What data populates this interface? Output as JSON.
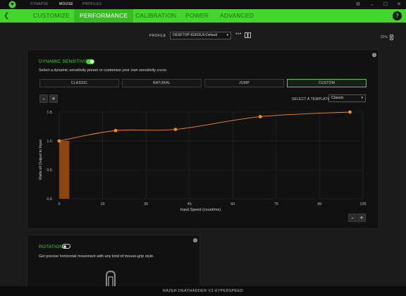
{
  "top_tabs": [
    "SYNAPSE",
    "MOUSE",
    "PROFILES"
  ],
  "active_top_tab": "MOUSE",
  "window_controls": [
    "⚙",
    "–",
    "☐",
    "✕"
  ],
  "nav": {
    "tabs": [
      "CUSTOMIZE",
      "PERFORMANCE",
      "CALIBRATION",
      "POWER",
      "ADVANCED"
    ],
    "active": "PERFORMANCE",
    "help": "?"
  },
  "profile": {
    "label": "PROFILE",
    "value": "DESKTOP-6SKI3U0-Default",
    "more": "•••"
  },
  "battery": {
    "percent_text": "92%",
    "level": 0.92
  },
  "dynamic_sensitivity": {
    "title": "DYNAMIC SENSITIVITY",
    "enabled": true,
    "description": "Select a dynamic sensitivity preset or customize your own sensitivity curve.",
    "presets": [
      "CLASSIC",
      "NATURAL",
      "JUMP",
      "CUSTOM"
    ],
    "active_preset": "CUSTOM",
    "zoom_out": "-",
    "zoom_in": "+",
    "template_label": "SELECT A TEMPLATE",
    "template_value": "Classic"
  },
  "chart_data": {
    "type": "line",
    "xlabel": "Input Speed (count/ms)",
    "ylabel": "Ratio of Output to Input",
    "xlim": [
      0,
      105
    ],
    "ylim": [
      0,
      1.5
    ],
    "x_ticks": [
      0,
      15,
      30,
      45,
      60,
      75,
      90,
      105
    ],
    "y_ticks": [
      0.0,
      0.5,
      1.0,
      1.5
    ],
    "y_tick_labels": [
      "0.0",
      "0.5",
      "1.0",
      "1.5"
    ],
    "control_points": [
      {
        "x": 0,
        "y": 1.0
      },
      {
        "x": 19.5,
        "y": 1.18
      },
      {
        "x": 40.2,
        "y": 1.2
      },
      {
        "x": 69.5,
        "y": 1.42
      },
      {
        "x": 100.5,
        "y": 1.5
      }
    ],
    "highlight_range": [
      0,
      3.5
    ],
    "grid": true,
    "line_color": "#f08a2c",
    "highlight_color": "#8b4513"
  },
  "rotation": {
    "title": "ROTATION",
    "enabled": false,
    "description": "Get precise horizontal movement with any kind of mouse-grip style."
  },
  "footer": {
    "device": "RAZER DEATHADDER V3 HYPERSPEED"
  },
  "colors": {
    "accent": "#44d62c",
    "panel": "#111111",
    "background": "#1b1b1b"
  }
}
